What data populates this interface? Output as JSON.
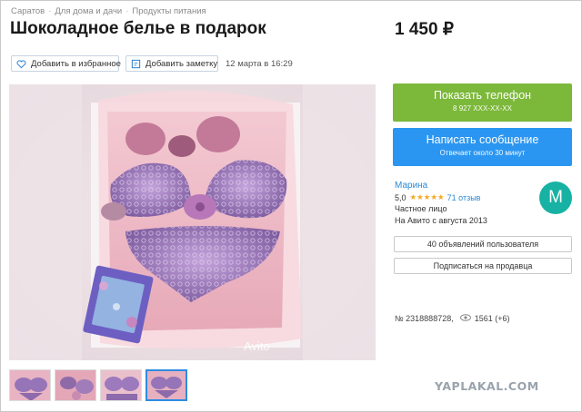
{
  "breadcrumbs": [
    "Саратов",
    "Для дома и дачи",
    "Продукты питания"
  ],
  "title": "Шоколадное белье в подарок",
  "price": "1 450 ₽",
  "actions": {
    "favorite_label": "Добавить в избранное",
    "note_label": "Добавить заметку",
    "date": "12 марта в 16:29"
  },
  "photo": {
    "watermark": "Avito",
    "thumbnails": 4,
    "active_thumbnail": 4
  },
  "contact": {
    "phone_label": "Показать телефон",
    "phone_masked": "8 927 XXX-XX-XX",
    "message_label": "Написать сообщение",
    "message_sub": "Отвечает около 30 минут"
  },
  "seller": {
    "name": "Марина",
    "rating": "5,0",
    "stars": "★★★★★",
    "reviews": "71 отзыв",
    "type": "Частное лицо",
    "since": "На Авито с августа 2013",
    "avatar_letter": "М",
    "avatar_color": "#17b2a3",
    "ads_button": "40 объявлений пользователя",
    "subscribe_button": "Подписаться на продавца"
  },
  "meta": {
    "ad_number": "№ 2318888728,",
    "views": "1561 (+6)"
  },
  "site_watermark": "YAPLAKAL.COM",
  "colors": {
    "phone_button": "#7cb83a",
    "message_button": "#2b96f1",
    "link": "#2b8ad8",
    "star": "#f4a91f"
  }
}
